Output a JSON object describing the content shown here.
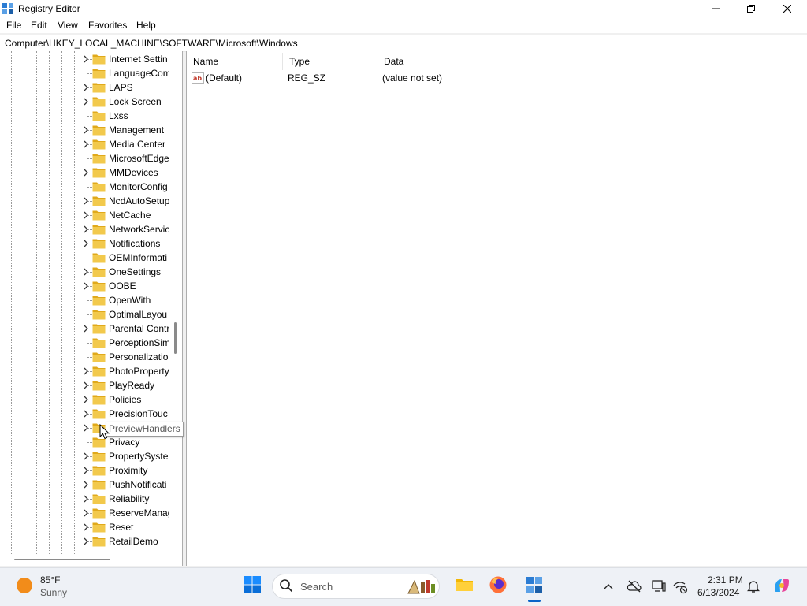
{
  "window": {
    "title": "Registry Editor"
  },
  "menu": {
    "file": "File",
    "edit": "Edit",
    "view": "View",
    "favorites": "Favorites",
    "help": "Help"
  },
  "address": {
    "path": "Computer\\HKEY_LOCAL_MACHINE\\SOFTWARE\\Microsoft\\Windows"
  },
  "tree": {
    "items": [
      {
        "label": "Internet Settin",
        "expandable": true
      },
      {
        "label": "LanguageCom",
        "expandable": false
      },
      {
        "label": "LAPS",
        "expandable": true
      },
      {
        "label": "Lock Screen",
        "expandable": true
      },
      {
        "label": "Lxss",
        "expandable": false
      },
      {
        "label": "Management",
        "expandable": true
      },
      {
        "label": "Media Center",
        "expandable": true
      },
      {
        "label": "MicrosoftEdge",
        "expandable": false
      },
      {
        "label": "MMDevices",
        "expandable": true
      },
      {
        "label": "MonitorConfig",
        "expandable": false
      },
      {
        "label": "NcdAutoSetup",
        "expandable": true
      },
      {
        "label": "NetCache",
        "expandable": true
      },
      {
        "label": "NetworkServic",
        "expandable": true
      },
      {
        "label": "Notifications",
        "expandable": true
      },
      {
        "label": "OEMInformati",
        "expandable": false
      },
      {
        "label": "OneSettings",
        "expandable": true
      },
      {
        "label": "OOBE",
        "expandable": true
      },
      {
        "label": "OpenWith",
        "expandable": false
      },
      {
        "label": "OptimalLayou",
        "expandable": false
      },
      {
        "label": "Parental Contr",
        "expandable": true
      },
      {
        "label": "PerceptionSim",
        "expandable": false
      },
      {
        "label": "Personalizatio",
        "expandable": false
      },
      {
        "label": "PhotoProperty",
        "expandable": true
      },
      {
        "label": "PlayReady",
        "expandable": true
      },
      {
        "label": "Policies",
        "expandable": true
      },
      {
        "label": "PrecisionTouc",
        "expandable": true
      },
      {
        "label": "",
        "expandable": true
      },
      {
        "label": "Privacy",
        "expandable": false
      },
      {
        "label": "PropertySyster",
        "expandable": true
      },
      {
        "label": "Proximity",
        "expandable": true
      },
      {
        "label": "PushNotificati",
        "expandable": true
      },
      {
        "label": "Reliability",
        "expandable": true
      },
      {
        "label": "ReserveManag",
        "expandable": true
      },
      {
        "label": "Reset",
        "expandable": true
      },
      {
        "label": "RetailDemo",
        "expandable": true
      }
    ],
    "tooltip": "PreviewHandlers"
  },
  "values": {
    "columns": {
      "name": "Name",
      "type": "Type",
      "data": "Data"
    },
    "rows": [
      {
        "name": "(Default)",
        "type": "REG_SZ",
        "data": "(value not set)",
        "icon": "string-value-icon"
      }
    ]
  },
  "taskbar": {
    "weather": {
      "temp": "85°F",
      "desc": "Sunny"
    },
    "search_label": "Search",
    "clock": {
      "time": "2:31 PM",
      "date": "6/13/2024"
    }
  },
  "colors": {
    "folder": "#f2c94c",
    "accent": "#0a64c8",
    "weather_sun": "#f28c1a"
  }
}
